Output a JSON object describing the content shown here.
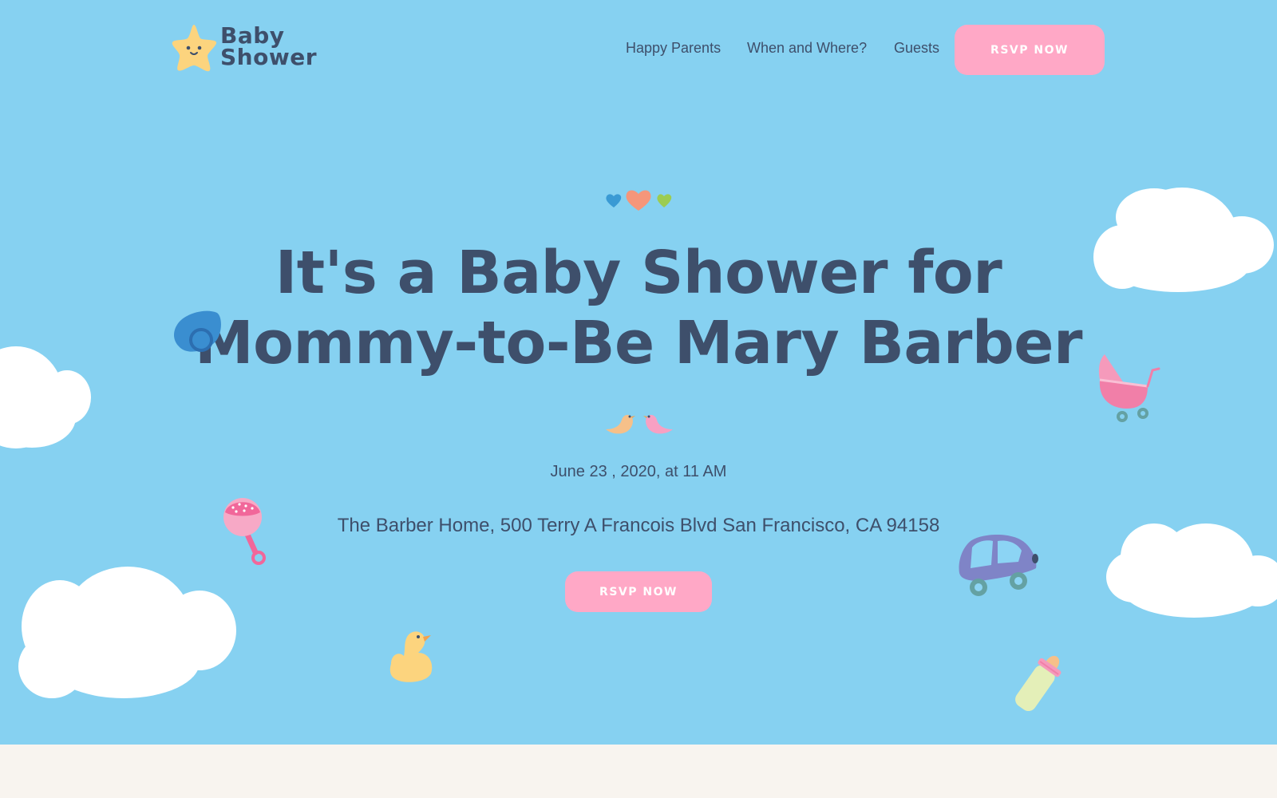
{
  "header": {
    "logo": {
      "line1": "Baby",
      "line2": "Shower"
    },
    "nav": [
      {
        "label": "Happy Parents"
      },
      {
        "label": "When and Where?"
      },
      {
        "label": "Guests"
      }
    ],
    "rsvp_label": "RSVP NOW"
  },
  "hero": {
    "title_line1": "It's a Baby Shower for",
    "title_line2": "Mommy-to-Be Mary Barber",
    "date": "June 23 , 2020, at 11 AM",
    "address": "The Barber Home, 500 Terry A Francois Blvd San Francisco, CA 94158",
    "rsvp_label": "RSVP NOW"
  },
  "colors": {
    "sky": "#86d1f1",
    "text": "#3e4f6b",
    "button": "#ffa8c6",
    "footer": "#f8f4ef"
  },
  "icons": [
    "star-logo-icon",
    "hearts-icon",
    "birds-icon",
    "cloud-icon",
    "pacifier-icon",
    "rattle-icon",
    "duck-icon",
    "stroller-icon",
    "toy-car-icon",
    "baby-bottle-icon"
  ]
}
